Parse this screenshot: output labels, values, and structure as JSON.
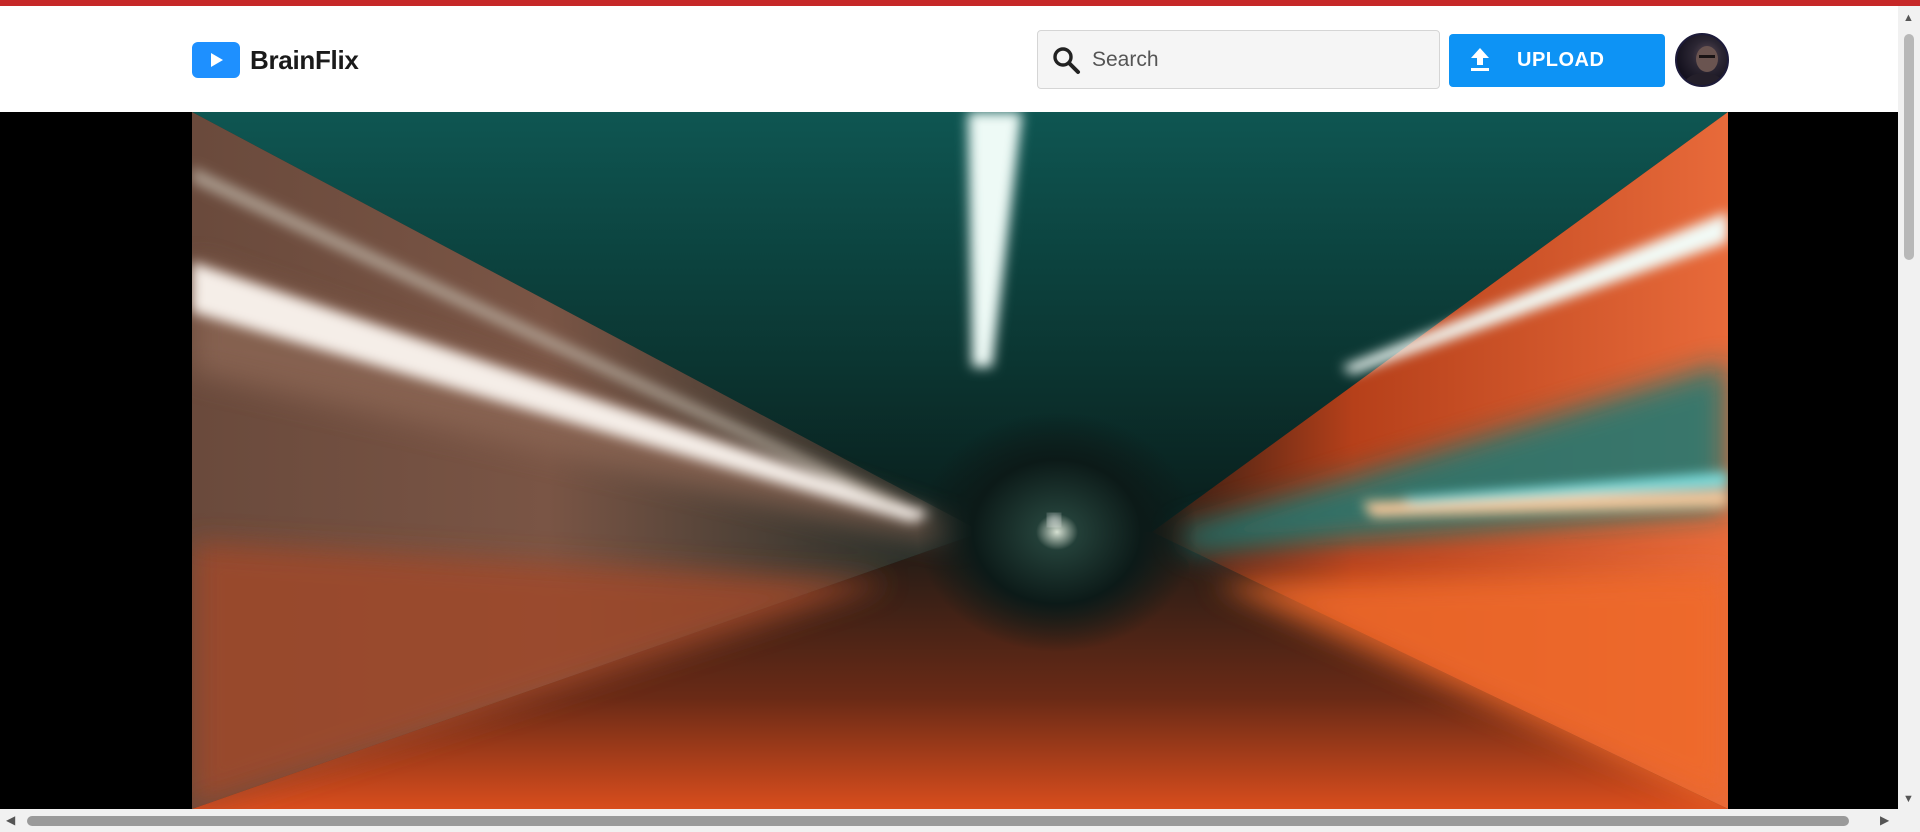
{
  "app": {
    "name": "BrainFlix",
    "logo_icon": "play-icon",
    "brand_color": "#0d93f5"
  },
  "search": {
    "placeholder": "Search",
    "icon": "search-icon"
  },
  "upload_button": {
    "label": "UPLOAD",
    "icon": "upload-icon"
  },
  "avatar": {
    "icon": "user-avatar"
  },
  "hero": {
    "image": "tunnel-motion-blur",
    "colors": {
      "teal": "#0e6b6a",
      "orange": "#e24e1b",
      "dark": "#0c1a18"
    }
  }
}
